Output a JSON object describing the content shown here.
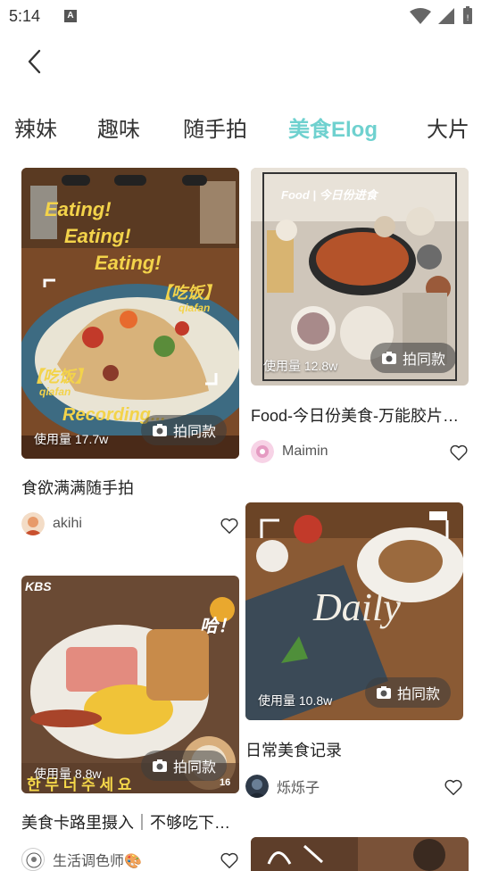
{
  "status_bar": {
    "time": "5:14",
    "notif_letter": "A"
  },
  "tabs": [
    {
      "label": "辣妹",
      "active": false
    },
    {
      "label": "趣味",
      "active": false
    },
    {
      "label": "随手拍",
      "active": false
    },
    {
      "label": "美食Elog",
      "active": true
    },
    {
      "label": "大片",
      "active": false
    }
  ],
  "same_label": "拍同款",
  "cards": [
    {
      "usage": "使用量 17.7w",
      "title": "食欲满满随手拍",
      "author": "akihi",
      "overlay": {
        "line1": "Eating!",
        "line2": "Eating!",
        "line3": "Eating!",
        "tag1": "【吃饭】",
        "tag1b": "qiafan",
        "tag2": "【吃饭】",
        "tag2b": "qiafan",
        "bottom": "Recording..."
      }
    },
    {
      "usage": "使用量 12.8w",
      "title": "Food-今日份美食-万能胶片…",
      "author": "Maimin",
      "overlay": {
        "top": "Food | 今日份进食"
      }
    },
    {
      "usage": "使用量 8.8w",
      "title": "美食卡路里摄入｜不够吃下…",
      "author": "生活调色师🎨",
      "overlay": {
        "kbs": "KBS",
        "hana": "哈！",
        "subtitle": "한 무 더 주 세 요",
        "num": "16"
      }
    },
    {
      "usage": "使用量 10.8w",
      "title": "日常美食记录",
      "author": "烁烁子",
      "overlay": {
        "daily": "Daily"
      }
    }
  ]
}
